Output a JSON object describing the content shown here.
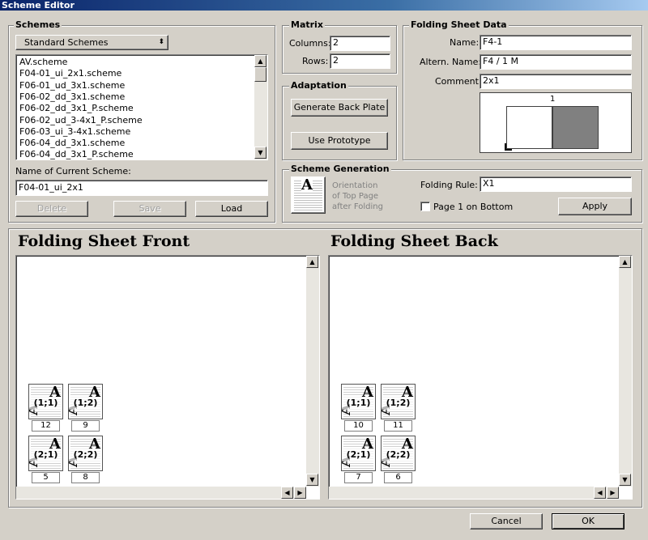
{
  "window": {
    "title": "Scheme Editor"
  },
  "schemes": {
    "group_title": "Schemes",
    "dropdown_value": "Standard Schemes",
    "list": [
      "AV.scheme",
      "F04-01_ui_2x1.scheme",
      "F06-01_ud_3x1.scheme",
      "F06-02_dd_3x1.scheme",
      "F06-02_dd_3x1_P.scheme",
      "F06-02_ud_3-4x1_P.scheme",
      "F06-03_ui_3-4x1.scheme",
      "F06-04_dd_3x1.scheme",
      "F06-04_dd_3x1_P.scheme"
    ],
    "current_label": "Name of Current Scheme:",
    "current_value": "F04-01_ui_2x1",
    "delete_label": "Delete",
    "save_label": "Save",
    "load_label": "Load"
  },
  "matrix": {
    "group_title": "Matrix",
    "columns_label": "Columns:",
    "columns_value": "2",
    "rows_label": "Rows:",
    "rows_value": "2"
  },
  "adaptation": {
    "group_title": "Adaptation",
    "generate_label": "Generate Back Plate",
    "prototype_label": "Use Prototype"
  },
  "folding_sheet": {
    "group_title": "Folding Sheet Data",
    "name_label": "Name:",
    "name_value": "F4-1",
    "altern_label": "Altern. Name:",
    "altern_value": "F4 / 1 M",
    "comment_label": "Comment:",
    "comment_value": "2x1",
    "preview_number": "1"
  },
  "scheme_generation": {
    "group_title": "Scheme Generation",
    "orientation_text": [
      "Orientation",
      "of Top Page",
      "after Folding"
    ],
    "rule_label": "Folding Rule:",
    "rule_value": "X1",
    "page1_label": "Page 1 on Bottom",
    "page1_checked": false,
    "apply_label": "Apply"
  },
  "front": {
    "title": "Folding Sheet Front",
    "pages": [
      {
        "label": "(1;1)",
        "number": "12"
      },
      {
        "label": "(1;2)",
        "number": "9"
      },
      {
        "label": "(2;1)",
        "number": "5"
      },
      {
        "label": "(2;2)",
        "number": "8"
      }
    ]
  },
  "back": {
    "title": "Folding Sheet Back",
    "pages": [
      {
        "label": "(1;1)",
        "number": "10"
      },
      {
        "label": "(1;2)",
        "number": "11"
      },
      {
        "label": "(2;1)",
        "number": "7"
      },
      {
        "label": "(2;2)",
        "number": "6"
      }
    ]
  },
  "footer": {
    "cancel_label": "Cancel",
    "ok_label": "OK"
  },
  "icons": {
    "page_letter": "A"
  },
  "colors": {
    "title_bar": "#0a246a",
    "face": "#d4d0c8",
    "preview_fill": "#808080"
  }
}
